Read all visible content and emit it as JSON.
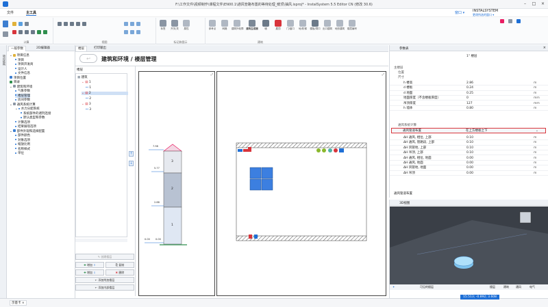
{
  "window": {
    "title": "F:\\工作文件\\视频制作\\课程文件\\EN00.1\\通风管路布置的等待处理_暖顶\\抽风.isproj* - InstalSystem 5.5 Editor CN (修改 30.6)",
    "brand": "INSTALSYSTEM"
  },
  "menu": {
    "file": "文件",
    "home": "主工具",
    "window_btn": "窗口 ▾",
    "account": "更改所选的窗口 ▾"
  },
  "ribbon": {
    "groups": [
      "计算",
      "视图",
      "标记和图示",
      "建筑"
    ],
    "buttons": [
      "标签",
      "开关/关",
      "属性",
      "参考点",
      "网格",
      "建筑外轮廓",
      "建筑生成器",
      "墙",
      "屋顶",
      "门/窗口",
      "地/阶梯",
      "楼板/洞口",
      "出口建筑",
      "地形建筑",
      "楼层编号"
    ]
  },
  "left_panel": {
    "side_tab": "项目结构",
    "tabs": [
      "一般参数",
      "2D编辑器",
      "楼层",
      "打印输出"
    ],
    "tree": [
      {
        "label": "项目信息",
        "level": 0,
        "expander": "⌄"
      },
      {
        "label": "项目",
        "level": 1
      },
      {
        "label": "项目开发商",
        "level": 1
      },
      {
        "label": "设计人",
        "level": 1
      },
      {
        "label": "文件信息",
        "level": 1
      },
      {
        "label": "项目位置",
        "level": 0
      },
      {
        "label": "目录",
        "level": 0
      },
      {
        "label": "建筑和环境",
        "level": 0,
        "expander": "⌄"
      },
      {
        "label": "气象参数",
        "level": 1
      },
      {
        "label": "楼层管理",
        "level": 1,
        "selected": true
      },
      {
        "label": "房间参数",
        "level": 1
      },
      {
        "label": "通风系统计算",
        "level": 0,
        "expander": "⌄"
      },
      {
        "label": "水力分配系统",
        "level": 1,
        "expander": "⌄"
      },
      {
        "label": "系统部件的诸列连接",
        "level": 2
      },
      {
        "label": "默认类型和参数",
        "level": 2
      },
      {
        "label": "计算选项",
        "level": 1
      },
      {
        "label": "结果展现选项",
        "level": 1
      },
      {
        "label": "部件外观和选择配置",
        "level": 0,
        "expander": "⌄"
      },
      {
        "label": "部件颜色",
        "level": 1
      },
      {
        "label": "对象选项",
        "level": 1
      },
      {
        "label": "缩放比例",
        "level": 1
      },
      {
        "label": "名称样式",
        "level": 1
      },
      {
        "label": "单位",
        "level": 1
      }
    ]
  },
  "center": {
    "page_title": "建筑和环境 / 楼层管理",
    "floor_header": "楼层",
    "floor_tree": [
      {
        "label": "建筑",
        "level": 0
      },
      {
        "label": "1",
        "level": 1
      },
      {
        "label": "1",
        "level": 2
      },
      {
        "label": "2",
        "level": 1,
        "selected": true
      },
      {
        "label": "2",
        "level": 2
      },
      {
        "label": "3",
        "level": 1
      },
      {
        "label": "3",
        "level": 2
      }
    ],
    "buttons": {
      "create": "创建楼层",
      "add_up": "增加",
      "copy": "复制",
      "add_down": "增加",
      "delete": "删除",
      "add_roof": "添加附加楼层",
      "add_inner": "添加内部楼层"
    },
    "elevation": {
      "levels": [
        "7.98",
        "5.77",
        "2.88",
        "0.00",
        "0.00"
      ],
      "floors": [
        "3",
        "2",
        "1"
      ]
    }
  },
  "properties": {
    "panel_title": "参数表",
    "header_value": "1° 楼层",
    "sections": [
      "主楼层",
      "位置",
      "尺寸"
    ],
    "rows": [
      {
        "name": "h 楼高",
        "value": "2.86",
        "unit": "m"
      },
      {
        "name": "d 楼板",
        "value": "0.24",
        "unit": "m"
      },
      {
        "name": "d 地面",
        "value": "0.25",
        "unit": "m"
      },
      {
        "name": "地面厚度（不含楼板厚度）",
        "value": "0",
        "unit": "mm"
      },
      {
        "name": "吊顶厚度",
        "value": "127",
        "unit": "mm"
      },
      {
        "name": "h 墙体",
        "value": "0.80",
        "unit": "m"
      }
    ],
    "vent_section": "通风系统计算",
    "select_row": {
      "name": "通风管道布置",
      "value": "在上方楼板之下"
    },
    "delta_rows": [
      {
        "name": "ΔH 通风, 相位, 上部",
        "value": "0.10",
        "unit": "m"
      },
      {
        "name": "ΔH 通风, 管路段, 上部",
        "value": "0.10",
        "unit": "m"
      },
      {
        "name": "ΔH 风管地, 上部",
        "value": "0.10",
        "unit": "m"
      },
      {
        "name": "ΔH 吊顶, 上部",
        "value": "0.10",
        "unit": "m"
      },
      {
        "name": "ΔH 通风, 相位, 地面",
        "value": "0.00",
        "unit": "m"
      },
      {
        "name": "ΔH 通风, 地面",
        "value": "0.00",
        "unit": "m"
      },
      {
        "name": "ΔH 风管地, 地面",
        "value": "0.00",
        "unit": "m"
      },
      {
        "name": "ΔH 吊顶",
        "value": "0.00",
        "unit": "m"
      }
    ],
    "footer": "通风管道布置"
  },
  "view3d": {
    "title": "3D视图",
    "visible_floors": "可见的楼层",
    "legend": [
      "楼层",
      "建筑",
      "通风",
      "电气"
    ]
  },
  "status": {
    "left_tab": "示意卡 ×",
    "coords": "15.513; -0.892; 3.608"
  },
  "colors": {
    "accent": "#1e6fd6",
    "duct_red": "#d8343b",
    "duct_green": "#8ab82d",
    "roof_pink": "#e91e63"
  }
}
